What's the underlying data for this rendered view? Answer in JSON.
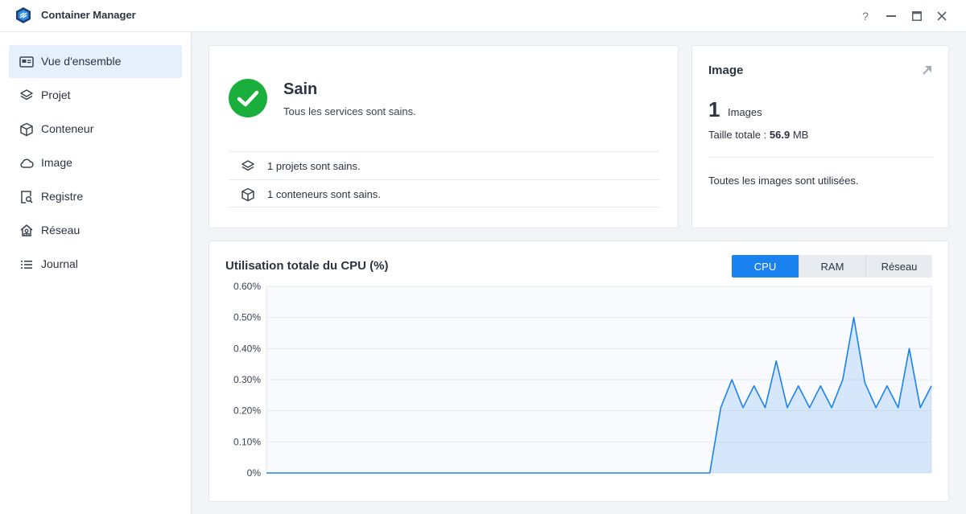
{
  "window": {
    "title": "Container Manager",
    "controls": [
      "?",
      "—",
      "☐",
      "✕"
    ]
  },
  "sidebar": {
    "items": [
      {
        "label": "Vue d'ensemble",
        "icon": "overview-icon",
        "active": true
      },
      {
        "label": "Projet",
        "icon": "layers-icon"
      },
      {
        "label": "Conteneur",
        "icon": "cube-icon"
      },
      {
        "label": "Image",
        "icon": "cloud-icon"
      },
      {
        "label": "Registre",
        "icon": "registry-search-icon"
      },
      {
        "label": "Réseau",
        "icon": "network-house-icon"
      },
      {
        "label": "Journal",
        "icon": "list-icon"
      }
    ]
  },
  "health": {
    "status": "Sain",
    "subtitle": "Tous les services sont sains.",
    "status_color": "#1aaf3c",
    "rows": [
      {
        "icon": "layers-icon",
        "text": "1 projets sont sains."
      },
      {
        "icon": "cube-icon",
        "text": "1 conteneurs sont sains."
      }
    ]
  },
  "image_card": {
    "title": "Image",
    "count": "1",
    "count_label": "Images",
    "size_label": "Taille totale :",
    "size_value": "56.9",
    "size_unit": "MB",
    "note": "Toutes les images sont utilisées."
  },
  "chart_card": {
    "title": "Utilisation totale du CPU (%)",
    "tabs": [
      {
        "label": "CPU",
        "active": true
      },
      {
        "label": "RAM"
      },
      {
        "label": "Réseau"
      }
    ],
    "accent": "#1a82f0"
  },
  "chart_data": {
    "type": "area",
    "title": "Utilisation totale du CPU (%)",
    "xlabel": "",
    "ylabel": "",
    "ylim": [
      0,
      0.6
    ],
    "yticks": [
      "0%",
      "0.10%",
      "0.20%",
      "0.30%",
      "0.40%",
      "0.50%",
      "0.60%"
    ],
    "grid": true,
    "x": [
      0,
      40,
      41,
      42,
      43,
      44,
      45,
      46,
      47,
      48,
      49,
      50,
      51,
      52,
      53,
      54,
      55,
      56,
      57,
      58,
      59,
      60
    ],
    "values": [
      0,
      0,
      0.21,
      0.3,
      0.21,
      0.28,
      0.21,
      0.36,
      0.21,
      0.28,
      0.21,
      0.28,
      0.21,
      0.3,
      0.5,
      0.29,
      0.21,
      0.28,
      0.21,
      0.4,
      0.21,
      0.28
    ],
    "x_range": [
      0,
      60
    ]
  }
}
